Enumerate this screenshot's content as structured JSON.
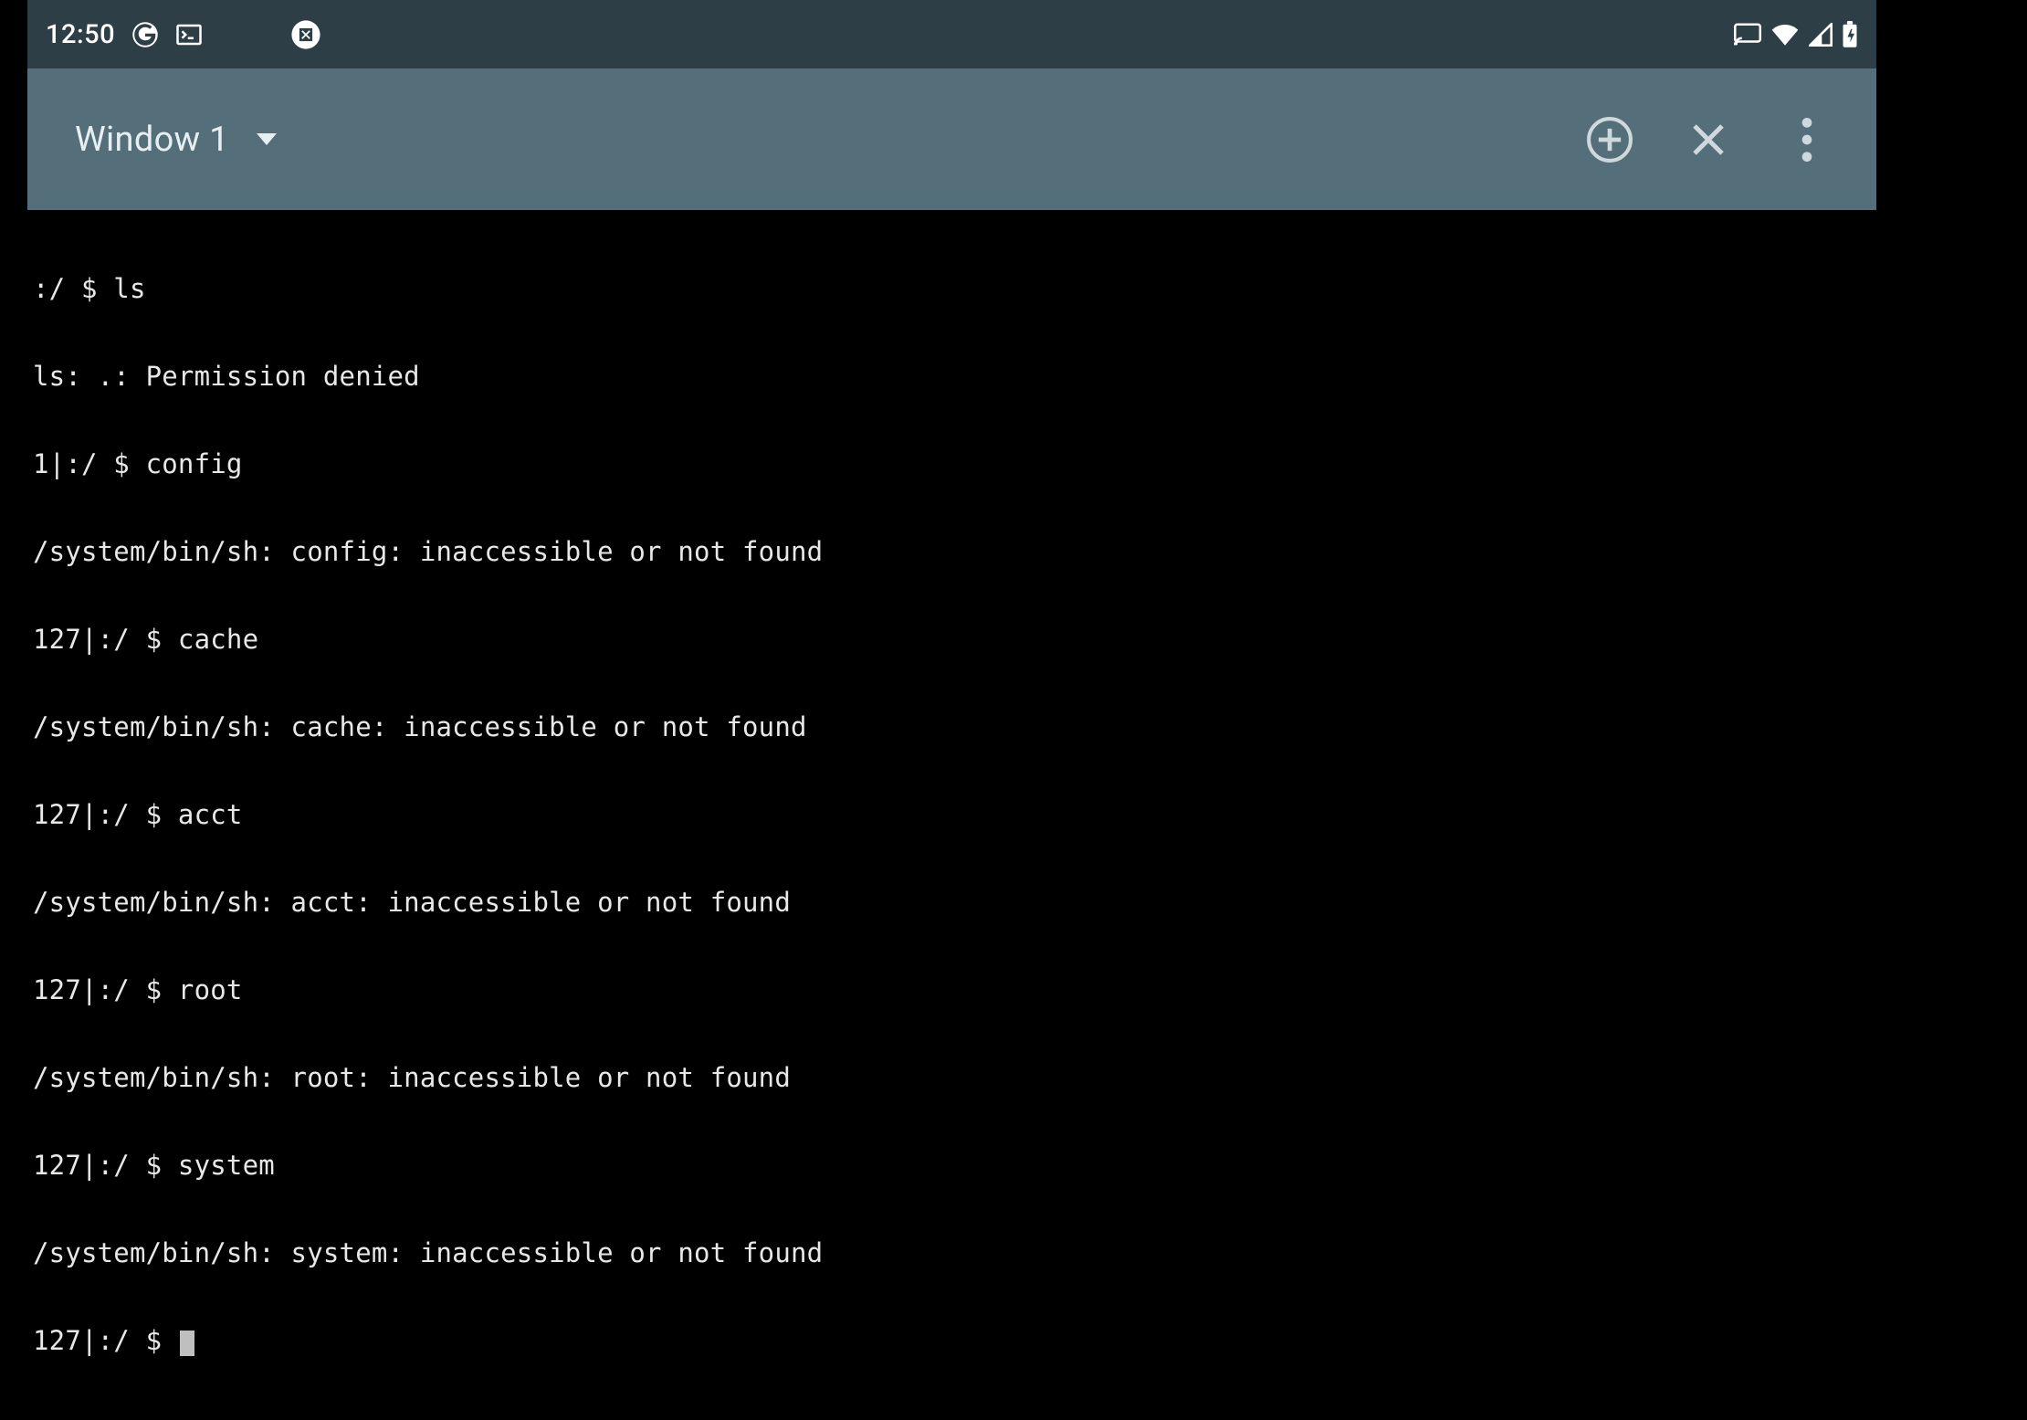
{
  "status": {
    "time": "12:50"
  },
  "appbar": {
    "window_title": "Window 1"
  },
  "terminal": {
    "lines": [
      ":/ $ ls",
      "ls: .: Permission denied",
      "1|:/ $ config",
      "/system/bin/sh: config: inaccessible or not found",
      "127|:/ $ cache",
      "/system/bin/sh: cache: inaccessible or not found",
      "127|:/ $ acct",
      "/system/bin/sh: acct: inaccessible or not found",
      "127|:/ $ root",
      "/system/bin/sh: root: inaccessible or not found",
      "127|:/ $ system",
      "/system/bin/sh: system: inaccessible or not found"
    ],
    "prompt": "127|:/ $ "
  }
}
